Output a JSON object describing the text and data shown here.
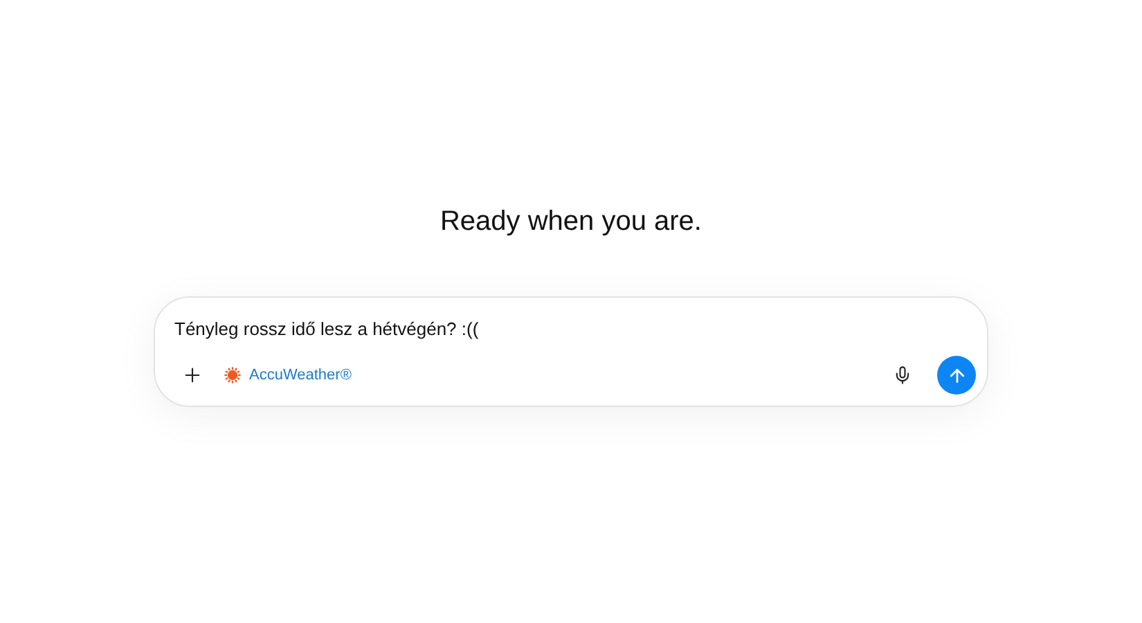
{
  "heading": "Ready when you are.",
  "composer": {
    "value": "Tényleg rossz idő lesz a hétvégén? :((",
    "tool_chip": {
      "label": "AccuWeather®",
      "color": "#f05a22"
    }
  }
}
